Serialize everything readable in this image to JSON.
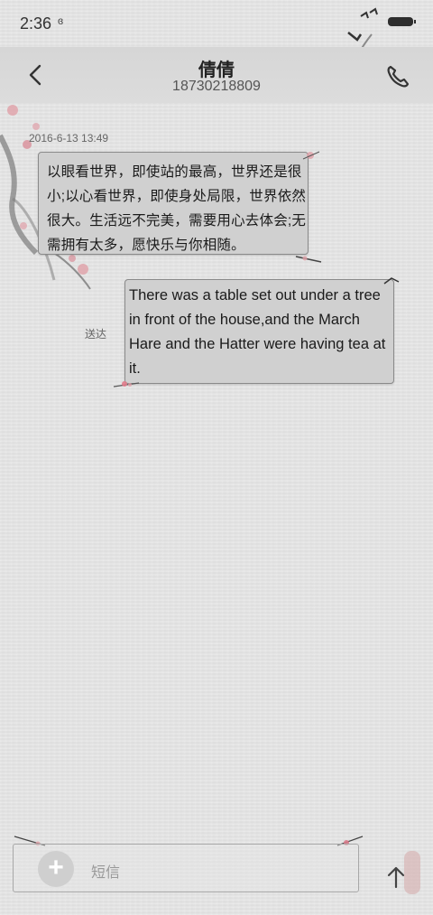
{
  "status_bar": {
    "time": "2:36",
    "extra": "ɞ"
  },
  "header": {
    "contact_name": "倩倩",
    "contact_number": "18730218809",
    "back_icon": "chevron-left-icon",
    "call_icon": "phone-icon"
  },
  "conversation": {
    "timestamp": "2016-6-13 13:49",
    "messages": [
      {
        "direction": "incoming",
        "text": "以眼看世界，即使站的最高，世界还是很小;以心看世界，即使身处局限，世界依然很大。生活远不完美，需要用心去体会;无需拥有太多，愿快乐与你相随。"
      },
      {
        "direction": "outgoing",
        "text": "There was a table set out under a tree in front of the house,and the March Hare and the Hatter were having tea at it.",
        "status": "送达"
      }
    ]
  },
  "composer": {
    "placeholder": "短信",
    "add_label": "+",
    "send_icon": "arrow-up-icon"
  },
  "colors": {
    "background": "#e4e4e4",
    "bubble": "#d0d0d0",
    "bubble_border": "#8a8a8a",
    "accent_ink": "#333333",
    "blossom": "#e0a0a8"
  }
}
